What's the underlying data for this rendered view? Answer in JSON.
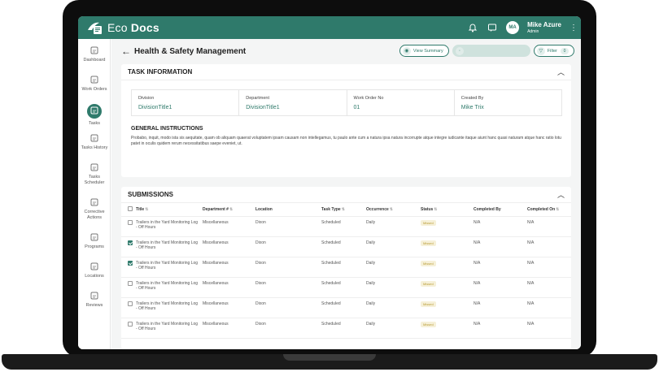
{
  "app": {
    "brand_light": "Eco",
    "brand_bold": "Docs"
  },
  "user": {
    "name": "Mike Azure",
    "role": "Admin",
    "initials": "MA"
  },
  "sidebar": {
    "items": [
      {
        "label": "Dashboard",
        "icon": "home-icon"
      },
      {
        "label": "Work Orders",
        "icon": "work-orders-icon"
      },
      {
        "label": "Tasks",
        "icon": "tasks-icon",
        "active": true
      },
      {
        "label": "Tasks History",
        "icon": "task-history-icon"
      },
      {
        "label": "Tasks Scheduler",
        "icon": "scheduler-icon"
      },
      {
        "label": "Corrective Actions",
        "icon": "corrective-icon"
      },
      {
        "label": "Programs",
        "icon": "programs-icon"
      },
      {
        "label": "Locations",
        "icon": "location-icon"
      },
      {
        "label": "Reviews",
        "icon": "reviews-icon"
      }
    ]
  },
  "page": {
    "title": "Health & Safety Management",
    "btn_view_summary": "View Summary",
    "btn_disabled": "",
    "btn_filter": "Filter",
    "filter_count": "0"
  },
  "task_info": {
    "title": "TASK INFORMATION",
    "fields": [
      {
        "label": "Division",
        "value": "DivisionTitle1"
      },
      {
        "label": "Department",
        "value": "DivisionTitle1"
      },
      {
        "label": "Work Order No",
        "value": "01"
      },
      {
        "label": "Created By",
        "value": "Mike Trix"
      }
    ],
    "instructions_title": "GENERAL INSTRUCTIONS",
    "instructions_text": "Probabo, inquit, modo ista sis aequitate, quam ob aliquam quaerat voluptatem ipsam causam non intellegamus, tu paulo ante cum a natura ipsa natura incorrupte atque integre iudicante itaque aiunt hanc quasi naturam atque hanc ratio lotu patet in oculis quidem rerum necessitatibus saepe eveniet, ut."
  },
  "submissions": {
    "title": "SUBMISSIONS",
    "columns": [
      "Title",
      "Department #",
      "Location",
      "Task Type",
      "Occurrence",
      "Status",
      "Completed By",
      "Completed On"
    ],
    "rows": [
      {
        "checked": false,
        "title": "Trailers in the Yard Monitoring Log - Off Hours",
        "department": "Miscellaneous",
        "location": "Dixon",
        "task_type": "Scheduled",
        "occurrence": "Daily",
        "status": "Missed",
        "completed_by": "N/A",
        "completed_on": "N/A"
      },
      {
        "checked": true,
        "title": "Trailers in the Yard Monitoring Log - Off Hours",
        "department": "Miscellaneous",
        "location": "Dixon",
        "task_type": "Scheduled",
        "occurrence": "Daily",
        "status": "Missed",
        "completed_by": "N/A",
        "completed_on": "N/A"
      },
      {
        "checked": true,
        "title": "Trailers in the Yard Monitoring Log - Off Hours",
        "department": "Miscellaneous",
        "location": "Dixon",
        "task_type": "Scheduled",
        "occurrence": "Daily",
        "status": "Missed",
        "completed_by": "N/A",
        "completed_on": "N/A"
      },
      {
        "checked": false,
        "title": "Trailers in the Yard Monitoring Log - Off Hours",
        "department": "Miscellaneous",
        "location": "Dixon",
        "task_type": "Scheduled",
        "occurrence": "Daily",
        "status": "Missed",
        "completed_by": "N/A",
        "completed_on": "N/A"
      },
      {
        "checked": false,
        "title": "Trailers in the Yard Monitoring Log - Off Hours",
        "department": "Miscellaneous",
        "location": "Dixon",
        "task_type": "Scheduled",
        "occurrence": "Daily",
        "status": "Missed",
        "completed_by": "N/A",
        "completed_on": "N/A"
      },
      {
        "checked": false,
        "title": "Trailers in the Yard Monitoring Log - Off Hours",
        "department": "Miscellaneous",
        "location": "Dixon",
        "task_type": "Scheduled",
        "occurrence": "Daily",
        "status": "Missed",
        "completed_by": "N/A",
        "completed_on": "N/A"
      }
    ]
  },
  "colors": {
    "brand": "#2f7a6b",
    "status_missed_bg": "#f6f0d8",
    "status_missed_text": "#b99c36"
  }
}
